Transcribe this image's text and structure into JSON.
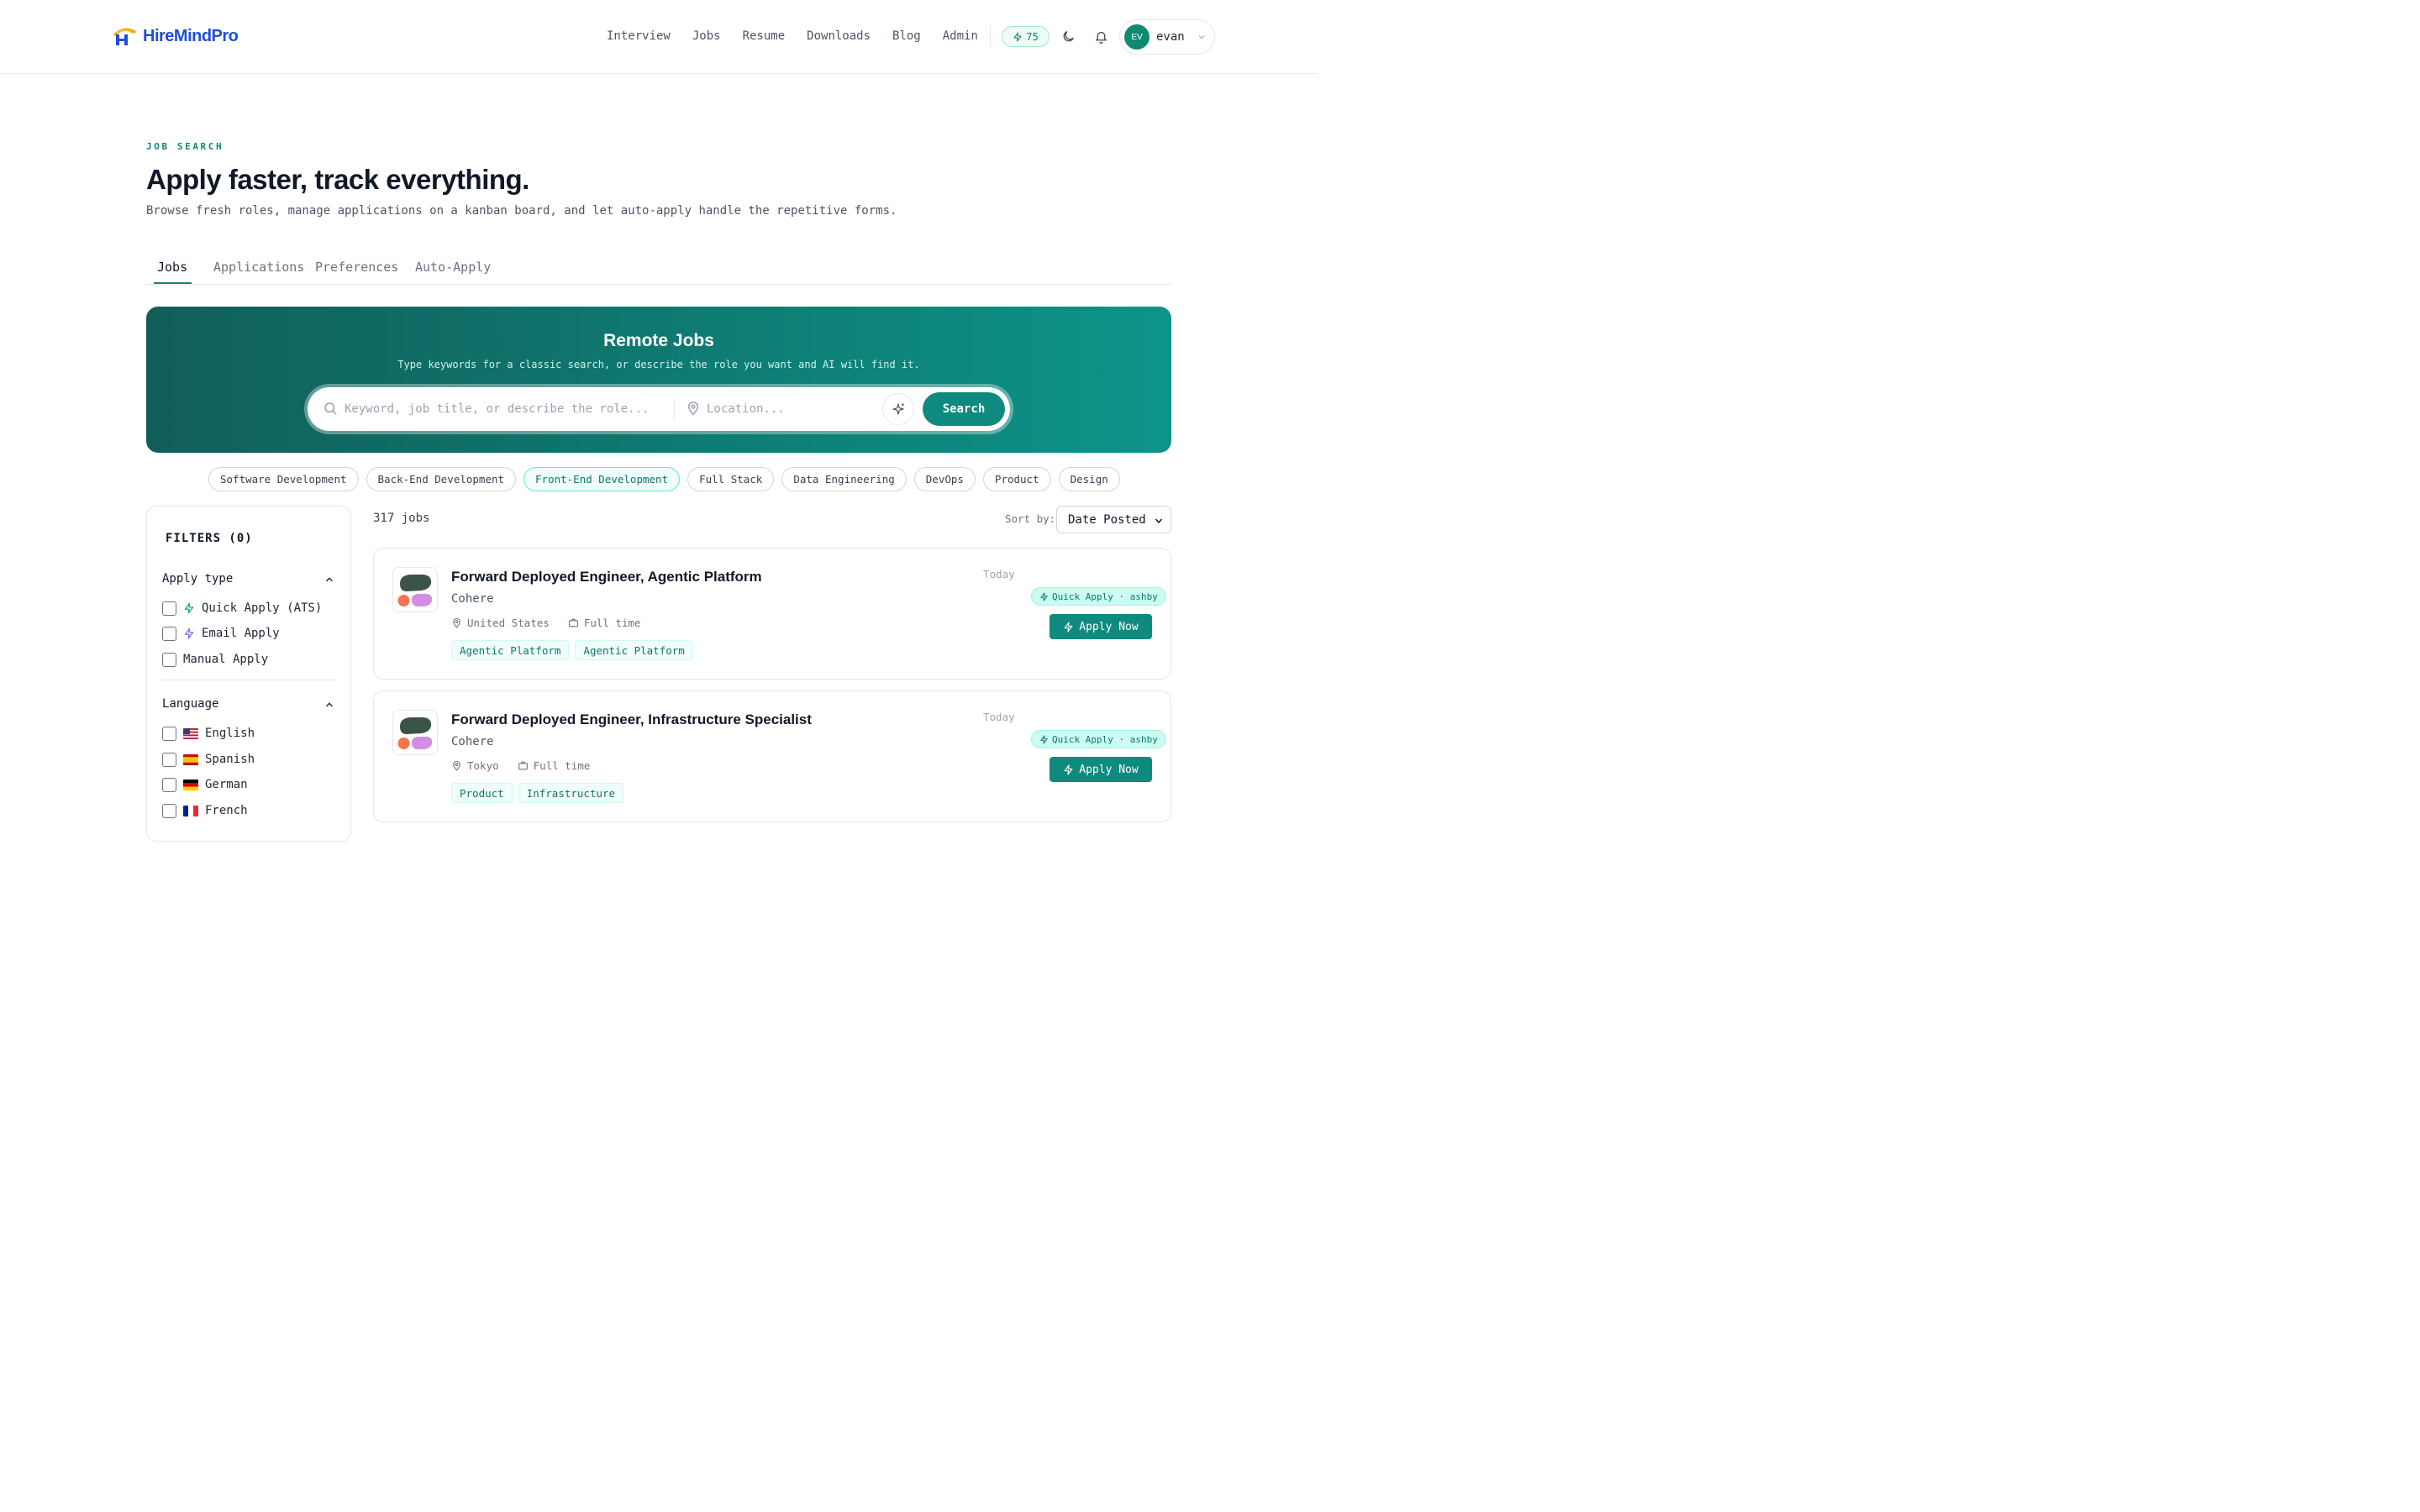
{
  "brand": {
    "name": "HireMindPro"
  },
  "nav": {
    "items": [
      "Interview",
      "Jobs",
      "Resume",
      "Downloads",
      "Blog",
      "Admin"
    ],
    "credits": "75",
    "user_initials": "EV",
    "user_name": "evan"
  },
  "hero": {
    "eyebrow": "JOB SEARCH",
    "title": "Apply faster, track everything.",
    "subtitle": "Browse fresh roles, manage applications on a kanban board, and let auto-apply handle the repetitive forms."
  },
  "tabs": [
    "Jobs",
    "Applications",
    "Preferences",
    "Auto-Apply"
  ],
  "active_tab": "Jobs",
  "banner": {
    "title": "Remote Jobs",
    "subtitle": "Type keywords for a classic search, or describe the role you want and AI will find it.",
    "search_placeholder": "Keyword, job title, or describe the role...",
    "location_placeholder": "Location...",
    "search_button": "Search"
  },
  "categories": [
    "Software Development",
    "Back-End Development",
    "Front-End Development",
    "Full Stack",
    "Data Engineering",
    "DevOps",
    "Product",
    "Design"
  ],
  "active_category": "Front-End Development",
  "filters": {
    "title": "FILTERS (0)",
    "apply_type": {
      "label": "Apply type",
      "options": [
        "Quick Apply (ATS)",
        "Email Apply",
        "Manual Apply"
      ]
    },
    "language": {
      "label": "Language",
      "options": [
        "English",
        "Spanish",
        "German",
        "French"
      ]
    }
  },
  "results": {
    "count": "317 jobs",
    "sort_label": "Sort by:",
    "sort_value": "Date Posted"
  },
  "jobs": [
    {
      "title": "Forward Deployed Engineer, Agentic Platform",
      "company": "Cohere",
      "location": "United States",
      "employment": "Full time",
      "tags": [
        "Agentic Platform",
        "Agentic Platform"
      ],
      "date": "Today",
      "badge": "Quick Apply · ashby",
      "apply_label": "Apply Now"
    },
    {
      "title": "Forward Deployed Engineer, Infrastructure Specialist",
      "company": "Cohere",
      "location": "Tokyo",
      "employment": "Full time",
      "tags": [
        "Product",
        "Infrastructure"
      ],
      "date": "Today",
      "badge": "Quick Apply · ashby",
      "apply_label": "Apply Now"
    }
  ],
  "colors": {
    "accent": "#0f8a7e",
    "banner_start": "#115e59",
    "banner_end": "#0d9488",
    "tag_text": "#0f766e",
    "brand_blue": "#1d4ed8",
    "brand_orange": "#f59e0b"
  }
}
